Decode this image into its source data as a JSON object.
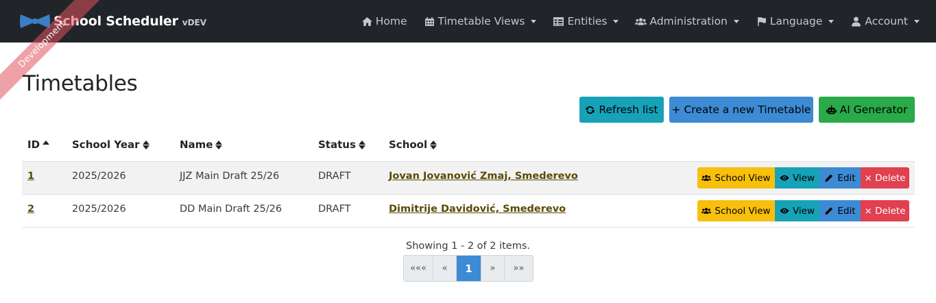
{
  "app": {
    "brand_title": "School Scheduler",
    "brand_version": "vDEV",
    "ribbon_text": "Development"
  },
  "nav": {
    "items": [
      {
        "label": "Home",
        "icon": "home-icon",
        "dropdown": false
      },
      {
        "label": "Timetable Views",
        "icon": "calendar-icon",
        "dropdown": true
      },
      {
        "label": "Entities",
        "icon": "table-icon",
        "dropdown": true
      },
      {
        "label": "Administration",
        "icon": "users-icon",
        "dropdown": true
      },
      {
        "label": "Language",
        "icon": "flag-icon",
        "dropdown": true
      },
      {
        "label": "Account",
        "icon": "user-icon",
        "dropdown": true
      }
    ]
  },
  "page": {
    "title": "Timetables",
    "buttons": {
      "refresh": "Refresh list",
      "create": "+ Create a new Timetable",
      "ai": "AI Generator"
    }
  },
  "table": {
    "columns": [
      "ID",
      "School Year",
      "Name",
      "Status",
      "School"
    ],
    "sorted_column": "ID",
    "rows": [
      {
        "id": "1",
        "school_year": "2025/2026",
        "name": "JJZ Main Draft 25/26",
        "status": "DRAFT",
        "school": "Jovan Jovanović Zmaj, Smederevo"
      },
      {
        "id": "2",
        "school_year": "2025/2026",
        "name": "DD Main Draft 25/26",
        "status": "DRAFT",
        "school": "Dimitrije Davidović, Smederevo"
      }
    ],
    "actions": {
      "school_view": "School View",
      "view": "View",
      "edit": "Edit",
      "delete": "× Delete"
    }
  },
  "pagination": {
    "summary": "Showing 1 - 2 of 2 items.",
    "first": "«««",
    "prev": "«",
    "current": "1",
    "next": "»",
    "last": "»»"
  },
  "colors": {
    "navbar": "#212529",
    "info": "#17a2b8",
    "primary": "#3d8bd4",
    "success": "#2aaa48",
    "warning": "#f8c00c",
    "danger": "#e0404f",
    "link": "#5a4a07"
  }
}
